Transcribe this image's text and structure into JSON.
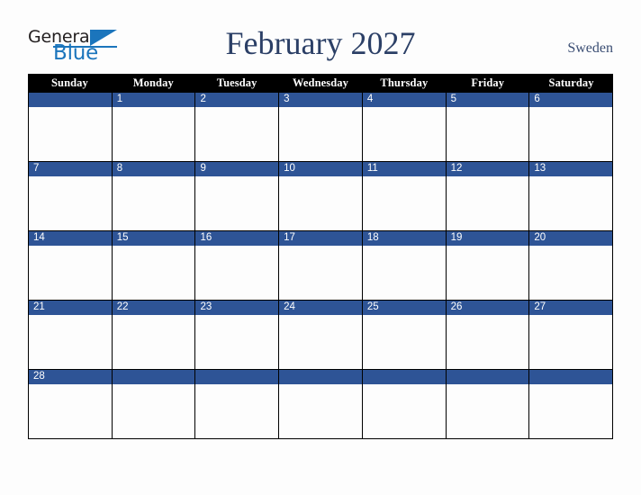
{
  "brand": {
    "name_part1": "General",
    "name_part2": "Blue",
    "triangle_icon": "triangle-icon",
    "colors": {
      "blue": "#1b75bc",
      "dark": "#231f20"
    }
  },
  "header": {
    "title": "February 2027",
    "country": "Sweden",
    "title_color": "#2b3f66",
    "country_color": "#3a4d73"
  },
  "calendar": {
    "colors": {
      "weekday_header_bg": "#000000",
      "weekday_header_text": "#ffffff",
      "day_bar_bg": "#2e5496",
      "day_number_text": "#ffffff",
      "cell_bg": "#fdfdfd",
      "grid_line": "#000000"
    },
    "weekdays": [
      "Sunday",
      "Monday",
      "Tuesday",
      "Wednesday",
      "Thursday",
      "Friday",
      "Saturday"
    ],
    "weeks": [
      [
        "",
        "1",
        "2",
        "3",
        "4",
        "5",
        "6"
      ],
      [
        "7",
        "8",
        "9",
        "10",
        "11",
        "12",
        "13"
      ],
      [
        "14",
        "15",
        "16",
        "17",
        "18",
        "19",
        "20"
      ],
      [
        "21",
        "22",
        "23",
        "24",
        "25",
        "26",
        "27"
      ],
      [
        "28",
        "",
        "",
        "",
        "",
        "",
        ""
      ]
    ]
  }
}
